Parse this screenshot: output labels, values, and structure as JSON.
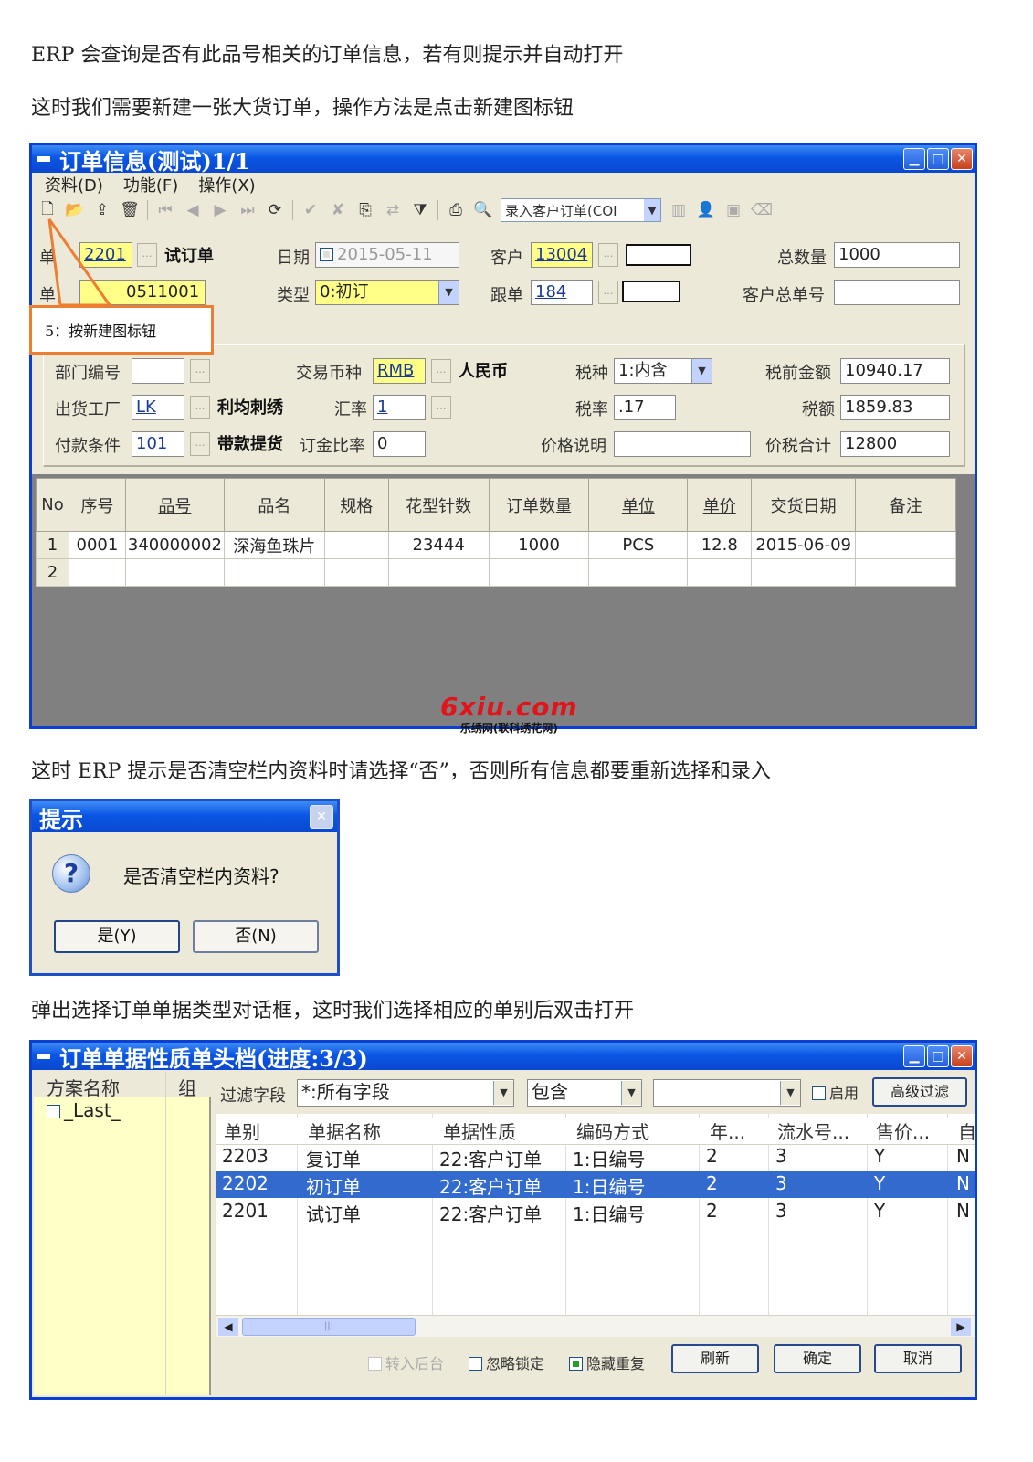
{
  "paragraphs": {
    "p1": "ERP 会查询是否有此品号相关的订单信息，若有则提示并自动打开",
    "p2": "这时我们需要新建一张大货订单，操作方法是点击新建图标钮",
    "p3": "这时 ERP 提示是否清空栏内资料时请选择“否”，否则所有信息都要重新选择和录入",
    "p4": "弹出选择订单单据类型对话框，这时我们选择相应的单别后双击打开"
  },
  "order_window": {
    "title": "订单信息(测试)1/1",
    "menu": [
      "资料(D)",
      "功能(F)",
      "操作(X)"
    ],
    "toolbar_combo": "录入客户订单(COI",
    "fields": {
      "danbie_label": "单",
      "danbie_value": "2201",
      "danbie_name": "试订单",
      "danhao_label": "单",
      "danhao_value": "0511001",
      "date_label": "日期",
      "date_value": "2015-05-11",
      "type_label": "类型",
      "type_value": "0:初订",
      "customer_label": "客户",
      "customer_value": "13004",
      "follow_label": "跟单",
      "follow_value": "184",
      "total_qty_label": "总数量",
      "total_qty_value": "1000",
      "cust_order_label": "客户总单号",
      "cust_order_value": "",
      "dept_label": "部门编号",
      "dept_value": "",
      "currency_label": "交易币种",
      "currency_value": "RMB",
      "currency_name": "人民币",
      "taxkind_label": "税种",
      "taxkind_value": "1:内含",
      "pretax_label": "税前金额",
      "pretax_value": "10940.17",
      "factory_label": "出货工厂",
      "factory_value": "LK",
      "factory_name": "利均刺绣",
      "rate_label": "汇率",
      "rate_value": "1",
      "taxrate_label": "税率",
      "taxrate_value": ".17",
      "tax_label": "税额",
      "tax_value": "1859.83",
      "payterm_label": "付款条件",
      "payterm_value": "101",
      "payterm_name": "带款提货",
      "deposit_label": "订金比率",
      "deposit_value": "0",
      "price_note_label": "价格说明",
      "price_note_value": "",
      "total_label": "价税合计",
      "total_value": "12800"
    },
    "grid_headers": [
      "No",
      "序号",
      "品号",
      "品名",
      "规格",
      "花型针数",
      "订单数量",
      "单位",
      "单价",
      "交货日期",
      "备注"
    ],
    "grid_rows": [
      [
        "1",
        "0001",
        "340000002",
        "深海鱼珠片",
        "",
        "23444",
        "1000",
        "PCS",
        "12.8",
        "2015-06-09",
        ""
      ],
      [
        "2",
        "",
        "",
        "",
        "",
        "",
        "",
        "",
        "",
        "",
        ""
      ]
    ],
    "callout": "5：按新建图标钮"
  },
  "watermark": {
    "big": "6xiu.com",
    "small": "乐绣网(联科绣花网)"
  },
  "prompt_dialog": {
    "title": "提示",
    "icon": "question-icon",
    "message": "是否清空栏内资料?",
    "yes": "是(Y)",
    "no": "否(N)"
  },
  "select_window": {
    "title": "订单单据性质单头档(进度:3/3)",
    "left_headers": [
      "方案名称",
      "组"
    ],
    "left_item": "_Last_",
    "filter_label": "过滤字段",
    "filter_field": "*:所有字段",
    "filter_op": "包含",
    "filter_value": "",
    "enable_label": "启用",
    "advanced_button": "高级过滤",
    "headers": [
      "单别",
      "单据名称",
      "单据性质",
      "编码方式",
      "年...",
      "流水号...",
      "售价...",
      "自"
    ],
    "rows": [
      [
        "2203",
        "复订单",
        "22:客户订单",
        "1:日编号",
        "2",
        "3",
        "Y",
        "N"
      ],
      [
        "2202",
        "初订单",
        "22:客户订单",
        "1:日编号",
        "2",
        "3",
        "Y",
        "N"
      ],
      [
        "2201",
        "试订单",
        "22:客户订单",
        "1:日编号",
        "2",
        "3",
        "Y",
        "N"
      ]
    ],
    "selected_row": 1,
    "options": [
      "转入后台",
      "忽略锁定",
      "隐藏重复"
    ],
    "buttons": [
      "刷新",
      "确定",
      "取消"
    ]
  },
  "colors": {
    "title_blue": "#0a56e4",
    "highlight": "#326bcd",
    "callout": "#ed7d31",
    "yellow_field": "#ffff88",
    "grid_gray": "#808080"
  }
}
